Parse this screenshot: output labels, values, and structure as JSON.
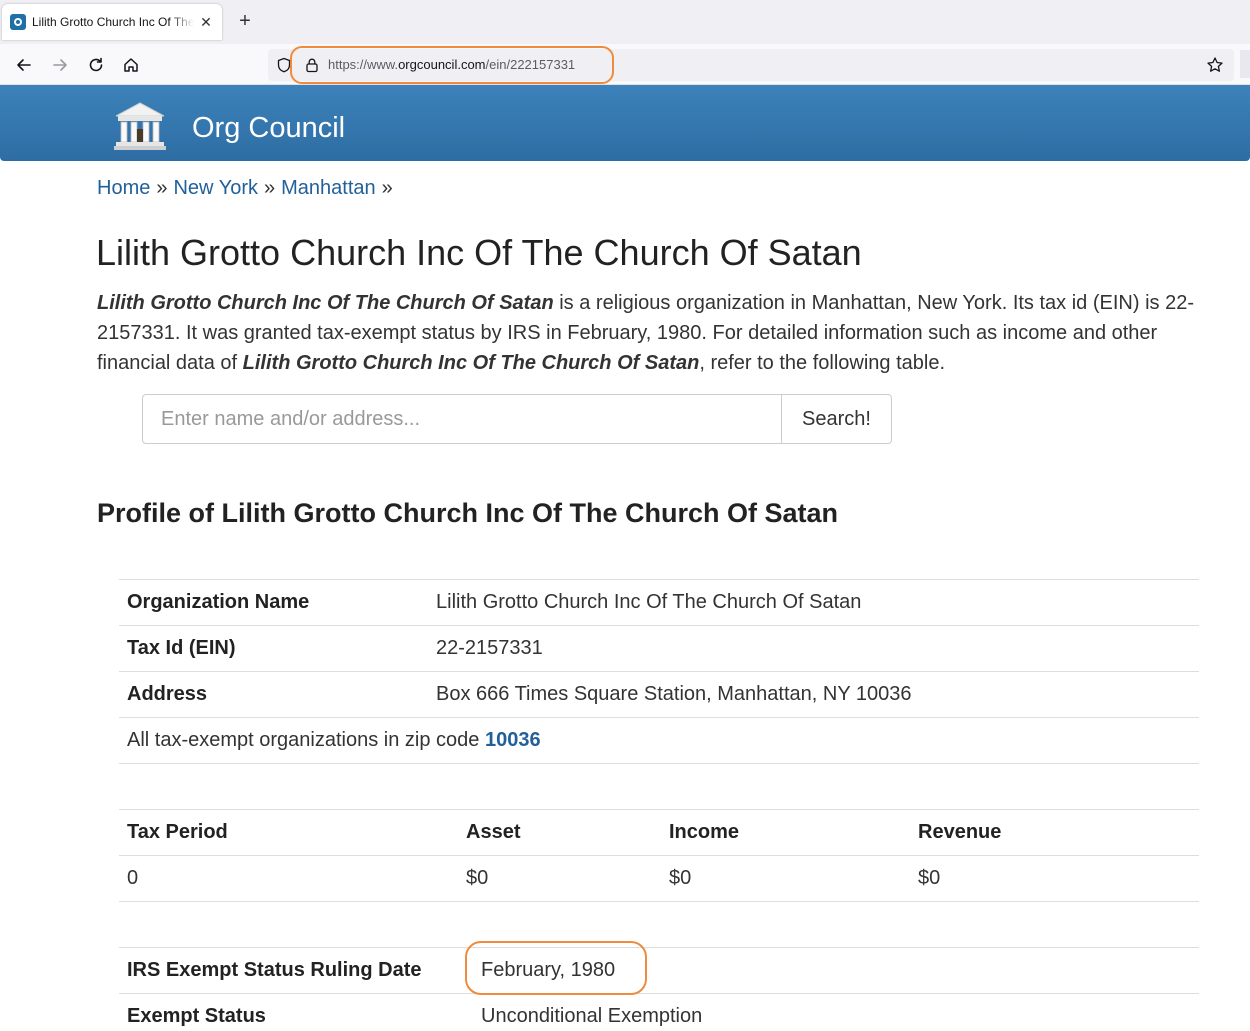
{
  "browser": {
    "tab_title": "Lilith Grotto Church Inc Of The Church Of Satan",
    "url_prefix": "https://www.",
    "url_host": "orgcouncil.com",
    "url_path": "/ein/222157331"
  },
  "site": {
    "brand": "Org Council"
  },
  "breadcrumb": {
    "home": "Home",
    "state": "New York",
    "city": "Manhattan",
    "separator": "»"
  },
  "page": {
    "title": "Lilith Grotto Church Inc Of The Church Of Satan",
    "intro": {
      "org_name": "Lilith Grotto Church Inc Of The Church Of Satan",
      "text_1": " is a religious organization in Manhattan, New York. Its tax id (EIN) is 22-2157331. It was granted tax-exempt status by IRS in February, 1980. For detailed information such as income and other financial data of ",
      "text_2": ", refer to the following table."
    }
  },
  "search": {
    "placeholder": "Enter name and/or address...",
    "button_label": "Search!"
  },
  "profile": {
    "heading": "Profile of Lilith Grotto Church Inc Of The Church Of Satan",
    "details": [
      {
        "label": "Organization Name",
        "value": "Lilith Grotto Church Inc Of The Church Of Satan"
      },
      {
        "label": "Tax Id (EIN)",
        "value": "22-2157331"
      },
      {
        "label": "Address",
        "value": "Box 666 Times Square Station, Manhattan, NY 10036"
      }
    ],
    "zip_text": "All tax-exempt organizations in zip code ",
    "zip_code": "10036",
    "financials": {
      "headers": [
        "Tax Period",
        "Asset",
        "Income",
        "Revenue"
      ],
      "row": [
        "0",
        "$0",
        "$0",
        "$0"
      ]
    },
    "status": [
      {
        "label": "IRS Exempt Status Ruling Date",
        "value": "February, 1980"
      },
      {
        "label": "Exempt Status",
        "value": "Unconditional Exemption"
      }
    ]
  },
  "colors": {
    "header_blue": "#3d82bb",
    "link_blue": "#23609a",
    "highlight_orange": "#f08a3c"
  }
}
